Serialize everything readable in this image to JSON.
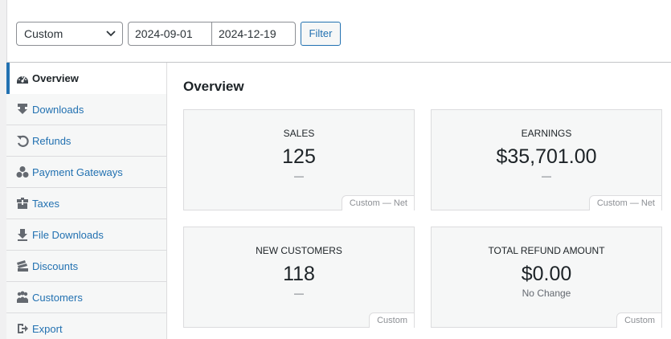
{
  "filter": {
    "range_select": "Custom",
    "start_date": "2024-09-01",
    "end_date": "2024-12-19",
    "filter_label": "Filter"
  },
  "sidebar": {
    "items": [
      {
        "label": "Overview",
        "icon": "dashboard-icon",
        "active": true
      },
      {
        "label": "Downloads",
        "icon": "download-icon"
      },
      {
        "label": "Refunds",
        "icon": "undo-icon"
      },
      {
        "label": "Payment Gateways",
        "icon": "groups-icon"
      },
      {
        "label": "Taxes",
        "icon": "bank-icon"
      },
      {
        "label": "File Downloads",
        "icon": "download-icon"
      },
      {
        "label": "Discounts",
        "icon": "tickets-icon"
      },
      {
        "label": "Customers",
        "icon": "users-icon"
      },
      {
        "label": "Export",
        "icon": "export-icon"
      }
    ]
  },
  "main": {
    "title": "Overview",
    "cards": [
      {
        "label": "Sales",
        "value": "125",
        "sub": "—",
        "tag": "Custom — Net"
      },
      {
        "label": "Earnings",
        "value": "$35,701.00",
        "sub": "—",
        "tag": "Custom — Net"
      },
      {
        "label": "New Customers",
        "value": "118",
        "sub": "—",
        "tag": "Custom"
      },
      {
        "label": "Total Refund Amount",
        "value": "$0.00",
        "sub": "No Change",
        "tag": "Custom"
      }
    ]
  },
  "colors": {
    "accent": "#2271b1",
    "border": "#dcdcde",
    "card_bg": "#f6f7f7"
  }
}
